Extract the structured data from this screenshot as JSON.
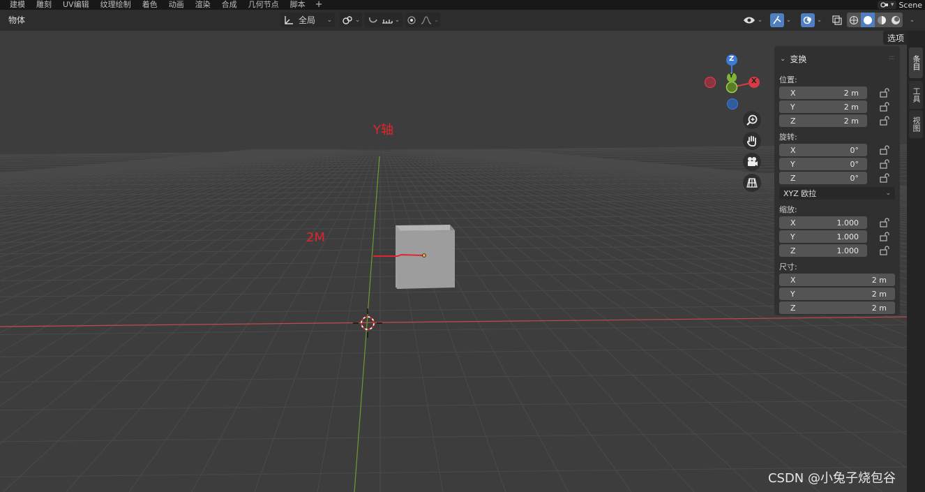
{
  "topbar": {
    "tabs": [
      "建模",
      "雕刻",
      "UV编辑",
      "纹理绘制",
      "着色",
      "动画",
      "渲染",
      "合成",
      "几何节点",
      "脚本"
    ],
    "add_label": "+",
    "scene_name": "Scene"
  },
  "header": {
    "mode_label": "物体",
    "transform_orientation": "全局"
  },
  "viewport": {
    "annotation_y_axis": "Y轴",
    "annotation_distance": "2M",
    "gizmo": {
      "x_label": "X",
      "y_label": "Y",
      "z_label": "Z"
    },
    "watermark": "CSDN @小兔子烧包谷",
    "colors": {
      "x_axis": "#d93a46",
      "y_axis": "#7fb33a",
      "z_axis": "#3d7bd6",
      "annotation": "#e0252c"
    }
  },
  "npanel": {
    "options_label": "选项",
    "title": "变换",
    "location_label": "位置:",
    "location": [
      {
        "axis": "X",
        "value": "2 m"
      },
      {
        "axis": "Y",
        "value": "2 m"
      },
      {
        "axis": "Z",
        "value": "2 m"
      }
    ],
    "rotation_label": "旋转:",
    "rotation": [
      {
        "axis": "X",
        "value": "0°"
      },
      {
        "axis": "Y",
        "value": "0°"
      },
      {
        "axis": "Z",
        "value": "0°"
      }
    ],
    "rotation_mode": "XYZ 欧拉",
    "scale_label": "缩放:",
    "scale": [
      {
        "axis": "X",
        "value": "1.000"
      },
      {
        "axis": "Y",
        "value": "1.000"
      },
      {
        "axis": "Z",
        "value": "1.000"
      }
    ],
    "dimensions_label": "尺寸:",
    "dimensions": [
      {
        "axis": "X",
        "value": "2 m"
      },
      {
        "axis": "Y",
        "value": "2 m"
      },
      {
        "axis": "Z",
        "value": "2 m"
      }
    ]
  },
  "sidebar_tabs": [
    "条目",
    "工具",
    "视图"
  ]
}
